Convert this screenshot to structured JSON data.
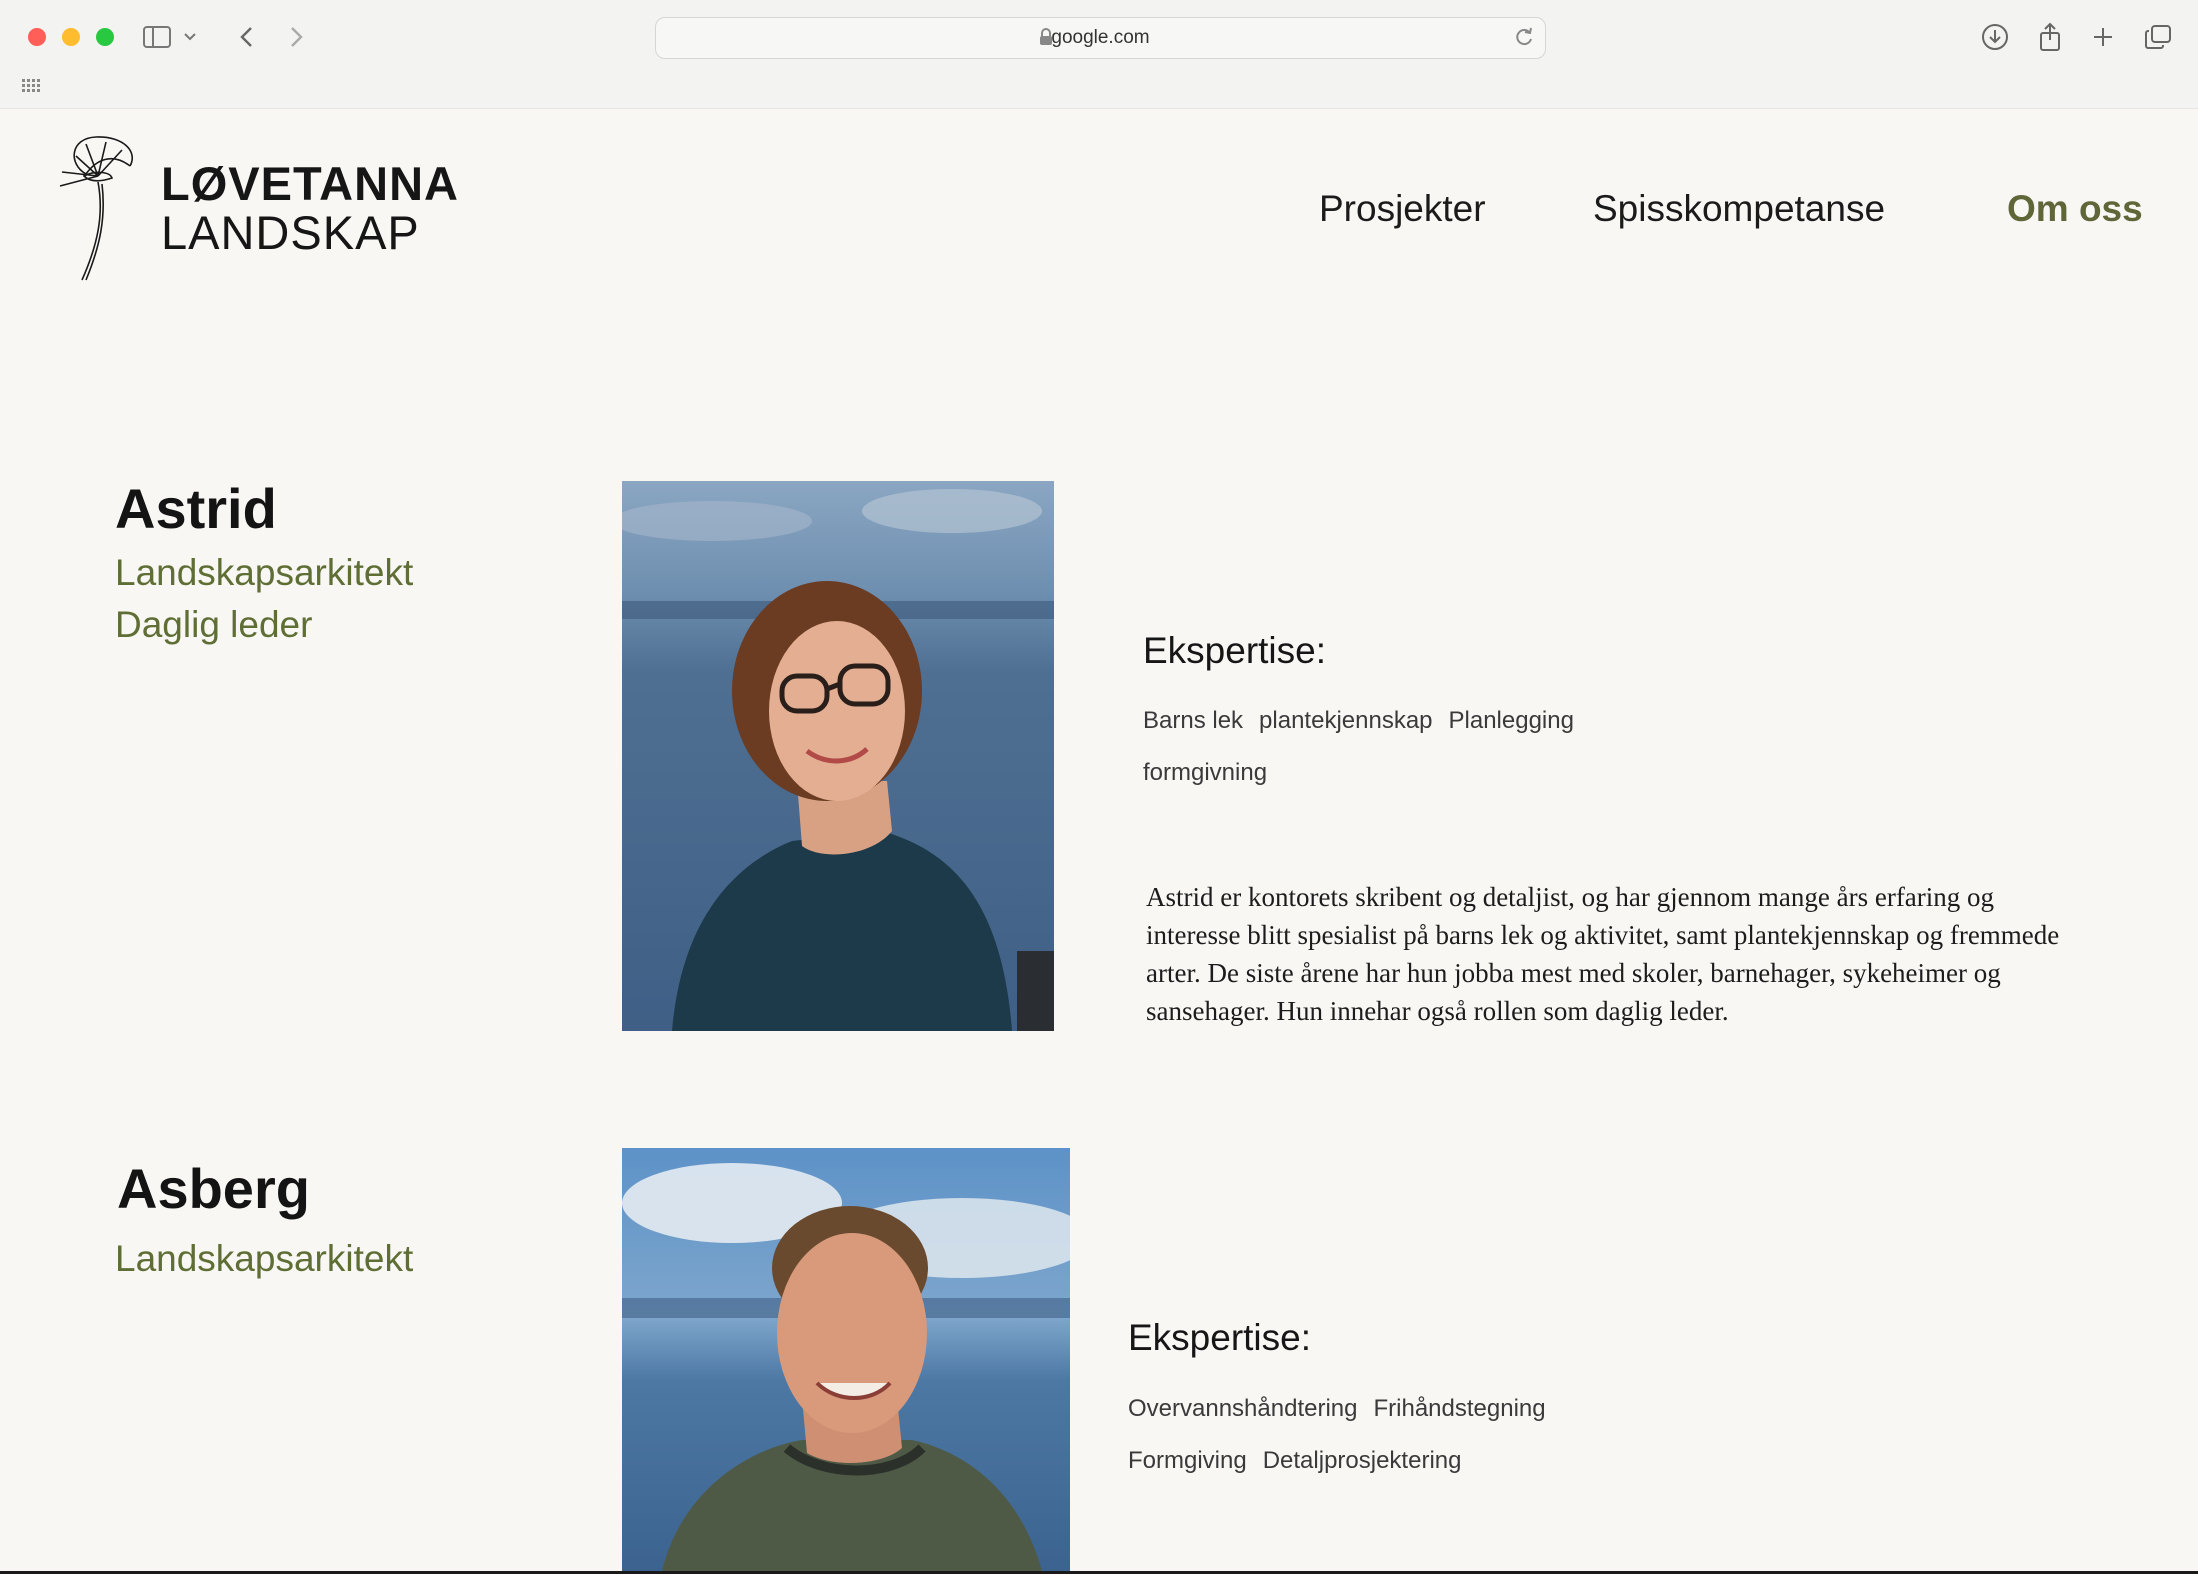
{
  "browser": {
    "url": "google.com",
    "icons": [
      "sidebar-icon",
      "chevron-down-icon",
      "back-icon",
      "forward-icon",
      "lock-icon",
      "reload-icon",
      "download-icon",
      "share-icon",
      "new-tab-icon",
      "tabs-overview-icon",
      "grid-icon"
    ]
  },
  "site": {
    "brand_line1": "LØVETANNA",
    "brand_line2": "LANDSKAP",
    "nav": [
      "Prosjekter",
      "Spisskompetanse",
      "Om oss"
    ],
    "active_nav": "Om oss",
    "accent_color": "#5f6e34"
  },
  "profiles": [
    {
      "name": "Astrid",
      "roles": [
        "Landskapsarkitekt",
        "Daglig leder"
      ],
      "expertise_heading": "Ekspertise:",
      "tag_rows": [
        [
          "Barns lek",
          "plantekjennskap",
          "Planlegging"
        ],
        [
          "formgivning"
        ]
      ],
      "bio": "Astrid er kontorets skribent og detaljist, og har gjennom mange års erfaring og interesse blitt spesialist på barns lek og aktivitet, samt plantekjennskap og fremmede arter. De siste årene har hun jobba mest med skoler, barnehager, sykeheimer og sansehager. Hun innehar også rollen som daglig leder."
    },
    {
      "name": "Asberg",
      "roles": [
        "Landskapsarkitekt"
      ],
      "expertise_heading": "Ekspertise:",
      "tag_rows": [
        [
          "Overvannshåndtering",
          "Frihåndstegning"
        ],
        [
          "Formgiving",
          "Detaljprosjektering"
        ]
      ]
    }
  ]
}
